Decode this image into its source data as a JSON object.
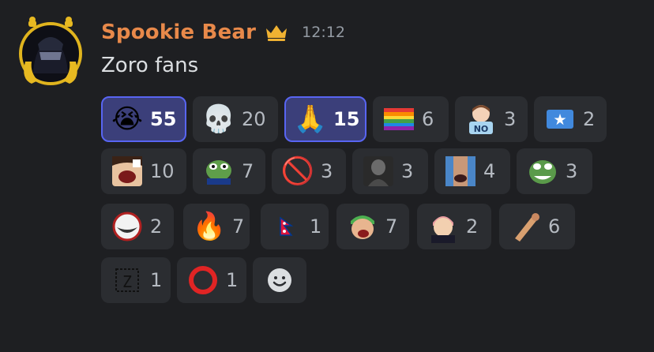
{
  "message": {
    "username": "Spookie Bear",
    "timestamp": "12:12",
    "text": "Zoro fans",
    "username_color": "#e8894a",
    "crown_icon": "crown-icon"
  },
  "reactions": [
    {
      "emoji": "😭",
      "icon": "loudly-crying-face",
      "count": "55",
      "active": true
    },
    {
      "emoji": "💀",
      "icon": "skull",
      "count": "20",
      "active": false
    },
    {
      "emoji": "🙏",
      "icon": "folded-hands",
      "count": "15",
      "active": true
    },
    {
      "emoji": "🏳️‍🌈",
      "icon": "rainbow-flag",
      "count": "6",
      "active": false
    },
    {
      "emoji": "",
      "icon": "custom-anime-no-sign",
      "count": "3",
      "active": false
    },
    {
      "emoji": "🇸🇴",
      "icon": "flag-somalia",
      "count": "2",
      "active": false
    },
    {
      "emoji": "",
      "icon": "custom-screaming-anime-face",
      "count": "10",
      "active": false
    },
    {
      "emoji": "",
      "icon": "custom-pepe-frog",
      "count": "7",
      "active": false
    },
    {
      "emoji": "🚫",
      "icon": "prohibited",
      "count": "3",
      "active": false
    },
    {
      "emoji": "",
      "icon": "custom-dark-character",
      "count": "3",
      "active": false
    },
    {
      "emoji": "",
      "icon": "custom-crying-man",
      "count": "4",
      "active": false
    },
    {
      "emoji": "",
      "icon": "custom-pepe-grin",
      "count": "3",
      "active": false
    },
    {
      "emoji": "",
      "icon": "custom-troll-face",
      "count": "2",
      "active": false
    },
    {
      "emoji": "🔥",
      "icon": "fire",
      "count": "7",
      "active": false
    },
    {
      "emoji": "🇳🇵",
      "icon": "flag-nepal",
      "count": "1",
      "active": false
    },
    {
      "emoji": "",
      "icon": "custom-zoro-face",
      "count": "7",
      "active": false
    },
    {
      "emoji": "",
      "icon": "custom-anime-boy",
      "count": "2",
      "active": false
    },
    {
      "emoji": "",
      "icon": "custom-brown-object",
      "count": "6",
      "active": false
    },
    {
      "emoji": "",
      "icon": "custom-z-box",
      "count": "1",
      "active": false
    },
    {
      "emoji": "⭕",
      "icon": "hollow-red-circle",
      "count": "1",
      "active": false
    }
  ],
  "add_reaction_icon": "add-reaction-smiley-icon"
}
